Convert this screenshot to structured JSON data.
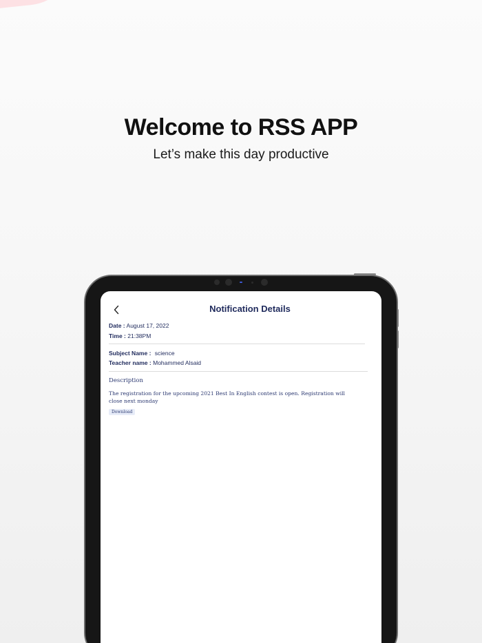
{
  "hero": {
    "title": "Welcome to RSS APP",
    "subtitle": "Let’s make this day productive"
  },
  "screen": {
    "title": "Notification Details",
    "date_label": "Date :",
    "date_value": "August 17, 2022",
    "time_label": "Time :",
    "time_value": "21:38PM",
    "subject_label": "Subject Name :",
    "subject_value": "science",
    "teacher_label": "Teacher name :",
    "teacher_value": "Mohammed Alsaid",
    "description_label": "Description",
    "description_text": "The registration for the upcoming 2021 Best In English contest is open. Registration will close next monday",
    "download_label": "Download"
  },
  "icons": {
    "back": "chevron-left-icon"
  },
  "colors": {
    "primary_text": "#1f2a5c",
    "accent_pink": "#fde1e4",
    "device_bezel": "#161616"
  }
}
